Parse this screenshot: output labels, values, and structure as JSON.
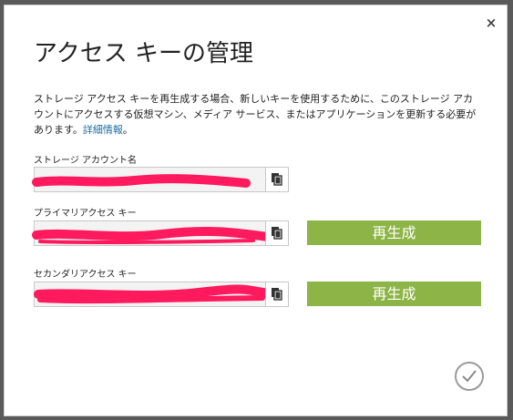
{
  "dialog": {
    "title": "アクセス キーの管理",
    "description": "ストレージ アクセス キーを再生成する場合、新しいキーを使用するために、このストレージ アカウントにアクセスする仮想マシン、メディア サービス、またはアプリケーションを更新する必要があります。",
    "details_link": "詳細情報",
    "description_end": "。",
    "close_glyph": "×"
  },
  "fields": {
    "account_name_label": "ストレージ アカウント名",
    "primary_key_label": "プライマリアクセス キー",
    "secondary_key_label": "セカンダリアクセス キー"
  },
  "buttons": {
    "regenerate_label": "再生成"
  },
  "colors": {
    "accent": "#8db446",
    "redaction": "#ff1a5e",
    "link": "#1f6f9f"
  },
  "icons": {
    "close": "close-icon",
    "copy": "copy-icon",
    "confirm": "checkmark-icon"
  }
}
